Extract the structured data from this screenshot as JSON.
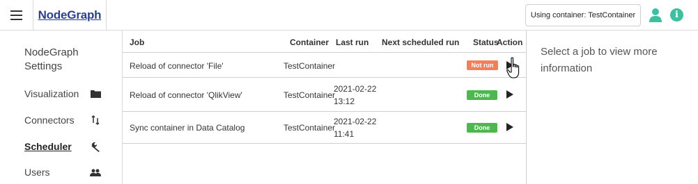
{
  "app": {
    "logo_text": "NodeGraph",
    "container_button": "Using container: TestContainer",
    "accent": "#2a3f8f",
    "info_color": "#3dbfa0"
  },
  "sidebar": {
    "title": "NodeGraph Settings",
    "items": [
      {
        "label": "Visualization",
        "icon": "folder-icon"
      },
      {
        "label": "Connectors",
        "icon": "arrows-updown-icon"
      },
      {
        "label": "Scheduler",
        "icon": "wrench-icon",
        "active": true
      },
      {
        "label": "Users",
        "icon": "users-icon"
      }
    ]
  },
  "table": {
    "headers": {
      "job": "Job",
      "container": "Container",
      "last_run": "Last run",
      "next_run": "Next scheduled run",
      "status": "Status",
      "action": "Action"
    },
    "rows": [
      {
        "job": "Reload of connector 'File'",
        "container": "TestContainer",
        "last_run_date": "",
        "last_run_time": "",
        "next_run": "",
        "status": "Not run",
        "status_color": "#f07f5a"
      },
      {
        "job": "Reload of connector 'QlikView'",
        "container": "TestContainer",
        "last_run_date": "2021-02-22",
        "last_run_time": "13:12",
        "next_run": "",
        "status": "Done",
        "status_color": "#4cb84f"
      },
      {
        "job": "Sync container in Data Catalog",
        "container": "TestContainer",
        "last_run_date": "2021-02-22",
        "last_run_time": "11:41",
        "next_run": "",
        "status": "Done",
        "status_color": "#4cb84f"
      }
    ]
  },
  "details": {
    "placeholder": "Select a job to view more information"
  }
}
